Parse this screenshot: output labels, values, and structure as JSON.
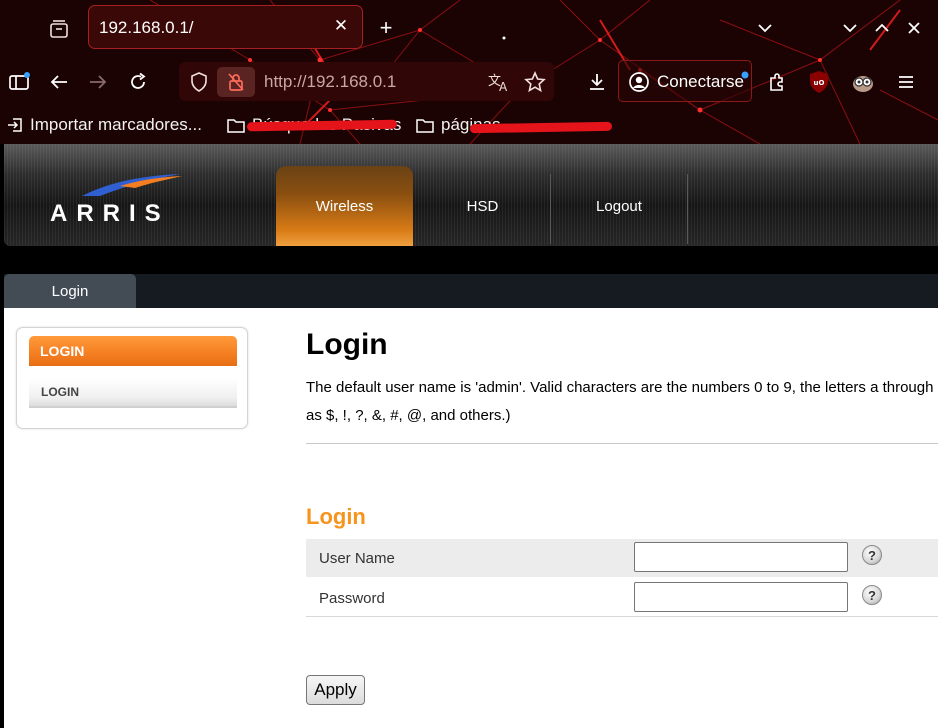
{
  "browser": {
    "tab": {
      "title": "192.168.0.1/",
      "close_glyph": "✕"
    },
    "new_tab_glyph": "+",
    "url": "http://192.168.0.1",
    "account_label": "Conectarse",
    "bookmarks": [
      {
        "label": "Importar marcadores...",
        "icon": "import-icon"
      },
      {
        "label": "Búsquedas Pasivas",
        "icon": "folder-icon"
      },
      {
        "label": "páginas",
        "icon": "folder-icon"
      }
    ],
    "theme_colors": {
      "background": "#1b0303",
      "accent": "#e4141a"
    }
  },
  "router": {
    "brand": "ARRIS",
    "nav": [
      {
        "label": "Wireless",
        "active": true
      },
      {
        "label": "HSD",
        "active": false
      },
      {
        "label": "Logout",
        "active": false
      }
    ],
    "subtab": "Login",
    "sidebar": {
      "header": "LOGIN",
      "item": "LOGIN"
    },
    "page_title": "Login",
    "description_line1": "The default user name is 'admin'. Valid characters are the numbers 0 to 9, the letters a through",
    "description_line2": "as $, !, ?, &, #, @, and others.)",
    "section_title": "Login",
    "fields": [
      {
        "label": "User Name",
        "value": "",
        "help": "?"
      },
      {
        "label": "Password",
        "value": "",
        "help": "?"
      }
    ],
    "apply_label": "Apply",
    "colors": {
      "accent_orange": "#f7941d",
      "sidebar_header": "#f47e21"
    }
  }
}
